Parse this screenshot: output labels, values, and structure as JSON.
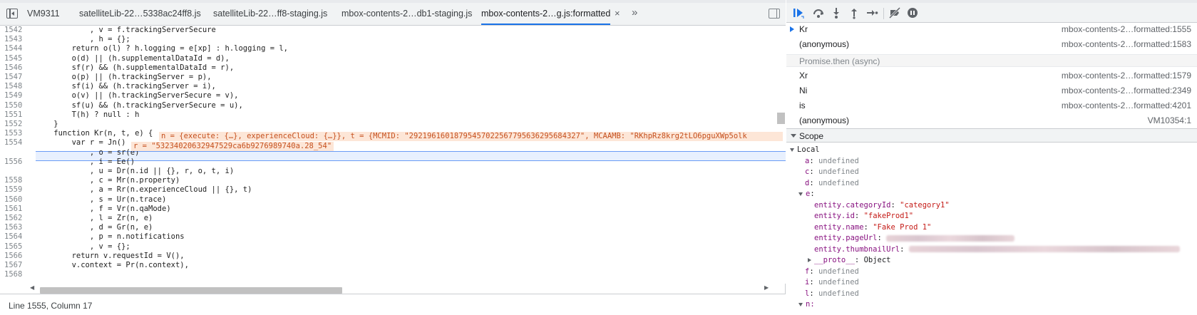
{
  "tabs": [
    {
      "label": "VM9311",
      "active": false
    },
    {
      "label": "satelliteLib-22…5338ac24ff8.js",
      "active": false
    },
    {
      "label": "satelliteLib-22…ff8-staging.js",
      "active": false
    },
    {
      "label": "mbox-contents-2…db1-staging.js",
      "active": false
    },
    {
      "label": "mbox-contents-2…g.js:formatted",
      "active": true
    }
  ],
  "tab_close": "×",
  "tab_more": "»",
  "code_lines": [
    {
      "n": "1542",
      "text": "            , v = f.trackingServerSecure"
    },
    {
      "n": "1543",
      "text": "            , h = {};"
    },
    {
      "n": "1544",
      "text": "        return o(l) ? h.logging = e[xp] : h.logging = l,"
    },
    {
      "n": "1545",
      "text": "        o(d) || (h.supplementalDataId = d),"
    },
    {
      "n": "1546",
      "text": "        sf(r) && (h.supplementalDataId = r),"
    },
    {
      "n": "1547",
      "text": "        o(p) || (h.trackingServer = p),"
    },
    {
      "n": "1548",
      "text": "        sf(i) && (h.trackingServer = i),"
    },
    {
      "n": "1549",
      "text": "        o(v) || (h.trackingServerSecure = v),"
    },
    {
      "n": "1550",
      "text": "        sf(u) && (h.trackingServerSecure = u),"
    },
    {
      "n": "1551",
      "text": "        T(h) ? null : h"
    },
    {
      "n": "1552",
      "text": "    }"
    },
    {
      "n": "1553",
      "text": "    function Kr(n, t, e) {"
    },
    {
      "n": "1554",
      "text": "        var r = Jn()"
    },
    {
      "n": "1555",
      "text": "            , o = sr(e)"
    },
    {
      "n": "1556",
      "text": "            , i = Ee()"
    },
    {
      "n": "1557",
      "text": "            , u = Dr(n.id || {}, r, o, t, i)"
    },
    {
      "n": "1558",
      "text": "            , c = Mr(n.property)"
    },
    {
      "n": "1559",
      "text": "            , a = Rr(n.experienceCloud || {}, t)"
    },
    {
      "n": "1560",
      "text": "            , s = Ur(n.trace)"
    },
    {
      "n": "1561",
      "text": "            , f = Vr(n.qaMode)"
    },
    {
      "n": "1562",
      "text": "            , l = Zr(n, e)"
    },
    {
      "n": "1563",
      "text": "            , d = Gr(n, e)"
    },
    {
      "n": "1564",
      "text": "            , p = n.notifications"
    },
    {
      "n": "1565",
      "text": "            , v = {};"
    },
    {
      "n": "1566",
      "text": "        return v.requestId = V(),"
    },
    {
      "n": "1567",
      "text": "        v.context = Pr(n.context),"
    },
    {
      "n": "1568",
      "text": ""
    }
  ],
  "breakpoints": [
    "1555",
    "1557"
  ],
  "inline_values": {
    "line1553": "n = {execute: {…}, experienceCloud: {…}}, t = {MCMID: \"29219616018795457022567795636295684327\", MCAAMB: \"RKhpRz8krg2tLO6pguXWp5olk",
    "line1554": "r = \"53234020632947529ca6b9276989740a.28_54\""
  },
  "status_bar": "Line 1555, Column 17",
  "debugger_toolbar": {
    "icons": [
      "resume-icon",
      "step-over-icon",
      "step-into-icon",
      "step-out-icon",
      "step-icon",
      "deactivate-breakpoints-icon",
      "pause-on-exceptions-icon"
    ]
  },
  "call_stack": [
    {
      "name": "Kr",
      "location": "mbox-contents-2…formatted:1555",
      "current": true
    },
    {
      "name": "(anonymous)",
      "location": "mbox-contents-2…formatted:1583",
      "current": false
    }
  ],
  "async_label": "Promise.then (async)",
  "call_stack_async": [
    {
      "name": "Xr",
      "location": "mbox-contents-2…formatted:1579"
    },
    {
      "name": "Ni",
      "location": "mbox-contents-2…formatted:2349"
    },
    {
      "name": "is",
      "location": "mbox-contents-2…formatted:4201"
    },
    {
      "name": "(anonymous)",
      "location": "VM10354:1"
    }
  ],
  "scope_title": "Scope",
  "local_title": "Local",
  "scope_local": [
    {
      "name": "a",
      "value": "undefined",
      "type": "undef"
    },
    {
      "name": "c",
      "value": "undefined",
      "type": "undef"
    },
    {
      "name": "d",
      "value": "undefined",
      "type": "undef"
    }
  ],
  "scope_e_name": "e",
  "scope_e": [
    {
      "name": "entity.categoryId",
      "value": "\"category1\"",
      "type": "str"
    },
    {
      "name": "entity.id",
      "value": "\"fakeProd1\"",
      "type": "str"
    },
    {
      "name": "entity.name",
      "value": "\"Fake Prod 1\"",
      "type": "str"
    }
  ],
  "scope_e_redacted": [
    {
      "name": "entity.pageUrl"
    },
    {
      "name": "entity.thumbnailUrl"
    }
  ],
  "proto": {
    "name": "__proto__",
    "value": "Object"
  },
  "scope_local_after": [
    {
      "name": "f",
      "value": "undefined",
      "type": "undef"
    },
    {
      "name": "i",
      "value": "undefined",
      "type": "undef"
    },
    {
      "name": "l",
      "value": "undefined",
      "type": "undef"
    }
  ],
  "scope_more": "n:"
}
